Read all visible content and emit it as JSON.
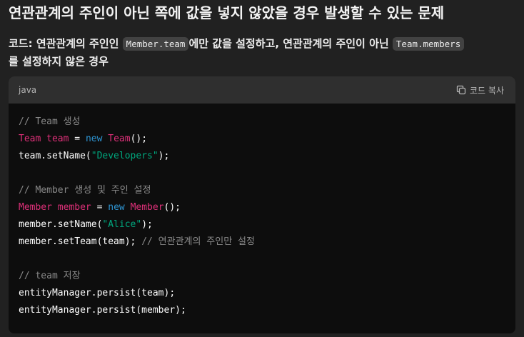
{
  "heading": "연관관계의 주인이 아닌 쪽에 값을 넣지 않았을 경우 발생할 수 있는 문제",
  "description": {
    "part1": "코드: 연관관계의 주인인 ",
    "code1": "Member.team",
    "part2": "에만 값을 설정하고, 연관관계의 주인이 아닌 ",
    "code2": "Team.members",
    "part3": "를 설정하지 않은 경우"
  },
  "code_block": {
    "language": "java",
    "copy_label": "코드 복사",
    "copy_icon": "copy-icon",
    "lines": [
      [
        {
          "t": "// Team 생성",
          "k": "comment"
        }
      ],
      [
        {
          "t": "Team",
          "k": "type"
        },
        {
          "t": " ",
          "k": "plain"
        },
        {
          "t": "team",
          "k": "type"
        },
        {
          "t": " = ",
          "k": "plain"
        },
        {
          "t": "new",
          "k": "kw"
        },
        {
          "t": " ",
          "k": "plain"
        },
        {
          "t": "Team",
          "k": "type"
        },
        {
          "t": "();",
          "k": "plain"
        }
      ],
      [
        {
          "t": "team.setName(",
          "k": "plain"
        },
        {
          "t": "\"Developers\"",
          "k": "str"
        },
        {
          "t": ");",
          "k": "plain"
        }
      ],
      [],
      [
        {
          "t": "// Member 생성 및 주인 설정",
          "k": "comment"
        }
      ],
      [
        {
          "t": "Member",
          "k": "type"
        },
        {
          "t": " ",
          "k": "plain"
        },
        {
          "t": "member",
          "k": "type"
        },
        {
          "t": " = ",
          "k": "plain"
        },
        {
          "t": "new",
          "k": "kw"
        },
        {
          "t": " ",
          "k": "plain"
        },
        {
          "t": "Member",
          "k": "type"
        },
        {
          "t": "();",
          "k": "plain"
        }
      ],
      [
        {
          "t": "member.setName(",
          "k": "plain"
        },
        {
          "t": "\"Alice\"",
          "k": "str"
        },
        {
          "t": ");",
          "k": "plain"
        }
      ],
      [
        {
          "t": "member.setTeam(team); ",
          "k": "plain"
        },
        {
          "t": "// 연관관계의 주인만 설정",
          "k": "comment"
        }
      ],
      [],
      [
        {
          "t": "// team 저장",
          "k": "comment"
        }
      ],
      [
        {
          "t": "entityManager.persist(team);",
          "k": "plain"
        }
      ],
      [
        {
          "t": "entityManager.persist(member);",
          "k": "plain"
        }
      ]
    ]
  },
  "colors": {
    "background": "#212121",
    "code_background": "#0d0d0d",
    "comment": "#8a8a8a",
    "type": "#df3079",
    "keyword": "#2e95d3",
    "string": "#00a67d"
  }
}
